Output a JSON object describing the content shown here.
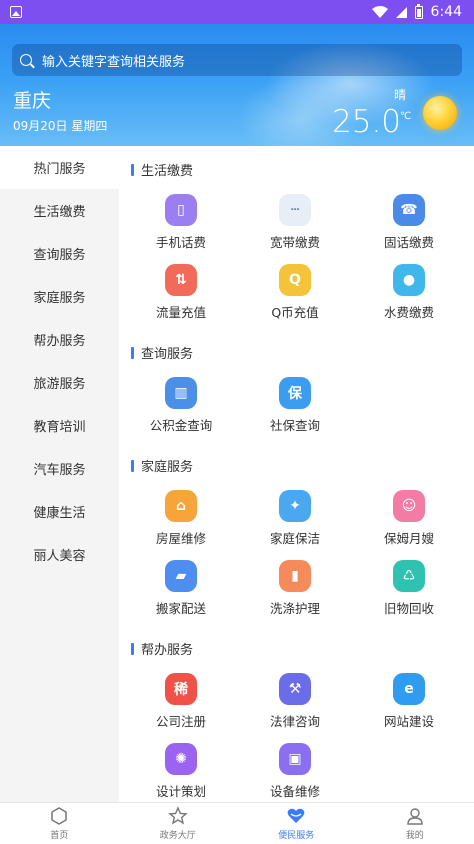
{
  "status": {
    "time": "6:44"
  },
  "search": {
    "placeholder": "输入关键字查询相关服务"
  },
  "weather": {
    "city": "重庆",
    "date": "09月20日 星期四",
    "condition": "晴",
    "temp": "25.0",
    "unit": "℃"
  },
  "sidebar": {
    "active_index": 0,
    "items": [
      "热门服务",
      "生活缴费",
      "查询服务",
      "家庭服务",
      "帮办服务",
      "旅游服务",
      "教育培训",
      "汽车服务",
      "健康生活",
      "丽人美容"
    ]
  },
  "sections": [
    {
      "title": "生活缴费",
      "items": [
        {
          "label": "手机话费",
          "icon": "mobile-phone-icon",
          "color": "#9b7ff0"
        },
        {
          "label": "宽带缴费",
          "icon": "router-icon",
          "color": "#e8eef8"
        },
        {
          "label": "固话缴费",
          "icon": "landline-phone-icon",
          "color": "#4a8be8"
        },
        {
          "label": "流量充值",
          "icon": "data-recharge-icon",
          "color": "#f26b5a"
        },
        {
          "label": "Q币充值",
          "icon": "q-coin-icon",
          "color": "#f5c33a"
        },
        {
          "label": "水费缴费",
          "icon": "water-drop-icon",
          "color": "#3fb7ea"
        }
      ]
    },
    {
      "title": "查询服务",
      "items": [
        {
          "label": "公积金查询",
          "icon": "building-icon",
          "color": "#4a90e8"
        },
        {
          "label": "社保查询",
          "icon": "social-security-shield-icon",
          "color": "#3b9cf0"
        }
      ]
    },
    {
      "title": "家庭服务",
      "items": [
        {
          "label": "房屋维修",
          "icon": "house-repair-icon",
          "color": "#f7a43a"
        },
        {
          "label": "家庭保洁",
          "icon": "cleaning-icon",
          "color": "#4aa8f0"
        },
        {
          "label": "保姆月嫂",
          "icon": "nanny-icon",
          "color": "#f27ca3"
        },
        {
          "label": "搬家配送",
          "icon": "truck-icon",
          "color": "#4e8ef0"
        },
        {
          "label": "洗涤护理",
          "icon": "laundry-icon",
          "color": "#f58a5a"
        },
        {
          "label": "旧物回收",
          "icon": "recycle-bin-icon",
          "color": "#30c2b0"
        }
      ]
    },
    {
      "title": "帮办服务",
      "items": [
        {
          "label": "公司注册",
          "icon": "company-register-icon",
          "color": "#f0524a"
        },
        {
          "label": "法律咨询",
          "icon": "gavel-icon",
          "color": "#6b6de8"
        },
        {
          "label": "网站建设",
          "icon": "ie-browser-icon",
          "color": "#2f9cf0"
        },
        {
          "label": "设计策划",
          "icon": "lightbulb-icon",
          "color": "#9a63f0"
        },
        {
          "label": "设备维修",
          "icon": "tv-repair-icon",
          "color": "#8a6ff0"
        }
      ]
    }
  ],
  "bottom_nav": {
    "active_index": 2,
    "items": [
      "首页",
      "政务大厅",
      "便民服务",
      "我的"
    ]
  }
}
